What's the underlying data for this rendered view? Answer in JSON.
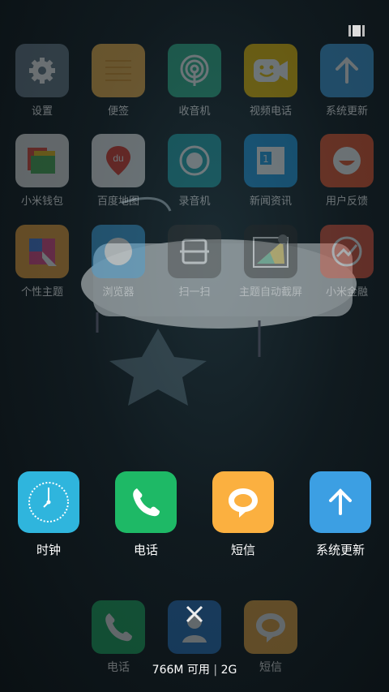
{
  "home_grid": [
    {
      "label": "设置",
      "icon": "gear-icon",
      "color": "#6a7d8c"
    },
    {
      "label": "便签",
      "icon": "notes-icon",
      "color": "#f7b64a"
    },
    {
      "label": "收音机",
      "icon": "radio-icon",
      "color": "#2fb98f"
    },
    {
      "label": "视频电话",
      "icon": "video-call-icon",
      "color": "#f5c400"
    },
    {
      "label": "系统更新",
      "icon": "arrow-up-icon",
      "color": "#3f9fe0"
    },
    {
      "label": "小米钱包",
      "icon": "wallet-icon",
      "color": "#e8e8e8"
    },
    {
      "label": "百度地图",
      "icon": "map-icon",
      "color": "#f2f2f2"
    },
    {
      "label": "录音机",
      "icon": "recorder-icon",
      "color": "#22aab2"
    },
    {
      "label": "新闻资讯",
      "icon": "news-icon",
      "color": "#1f9ee8"
    },
    {
      "label": "用户反馈",
      "icon": "feedback-icon",
      "color": "#f0592f"
    },
    {
      "label": "个性主题",
      "icon": "theme-icon",
      "color": "#f0a33a"
    },
    {
      "label": "浏览器",
      "icon": "browser-icon",
      "color": "#3ea8e8"
    },
    {
      "label": "扫一扫",
      "icon": "scan-icon",
      "color": "#3b3b3b"
    },
    {
      "label": "主题自动截屏",
      "icon": "screenshot-icon",
      "color": "#2a2a2a"
    },
    {
      "label": "小米金融",
      "icon": "finance-icon",
      "color": "#e8543a"
    }
  ],
  "recent_apps": [
    {
      "label": "时钟",
      "icon": "clock-icon",
      "color": "#2fb5dd"
    },
    {
      "label": "电话",
      "icon": "phone-icon",
      "color": "#1eb966"
    },
    {
      "label": "短信",
      "icon": "message-icon",
      "color": "#fbb040"
    },
    {
      "label": "系统更新",
      "icon": "arrow-up-icon",
      "color": "#3c9fe3"
    }
  ],
  "dock": [
    {
      "label": "电话",
      "icon": "phone-icon",
      "color": "#1eb966"
    },
    {
      "label": "联系人",
      "icon": "contacts-icon",
      "color": "#2a7bd0"
    },
    {
      "label": "短信",
      "icon": "message-icon",
      "color": "#fbb040"
    }
  ],
  "dock_labels": {
    "phone": "电话",
    "message": "短信"
  },
  "memory": {
    "available": "766M 可用",
    "network": "2G"
  }
}
